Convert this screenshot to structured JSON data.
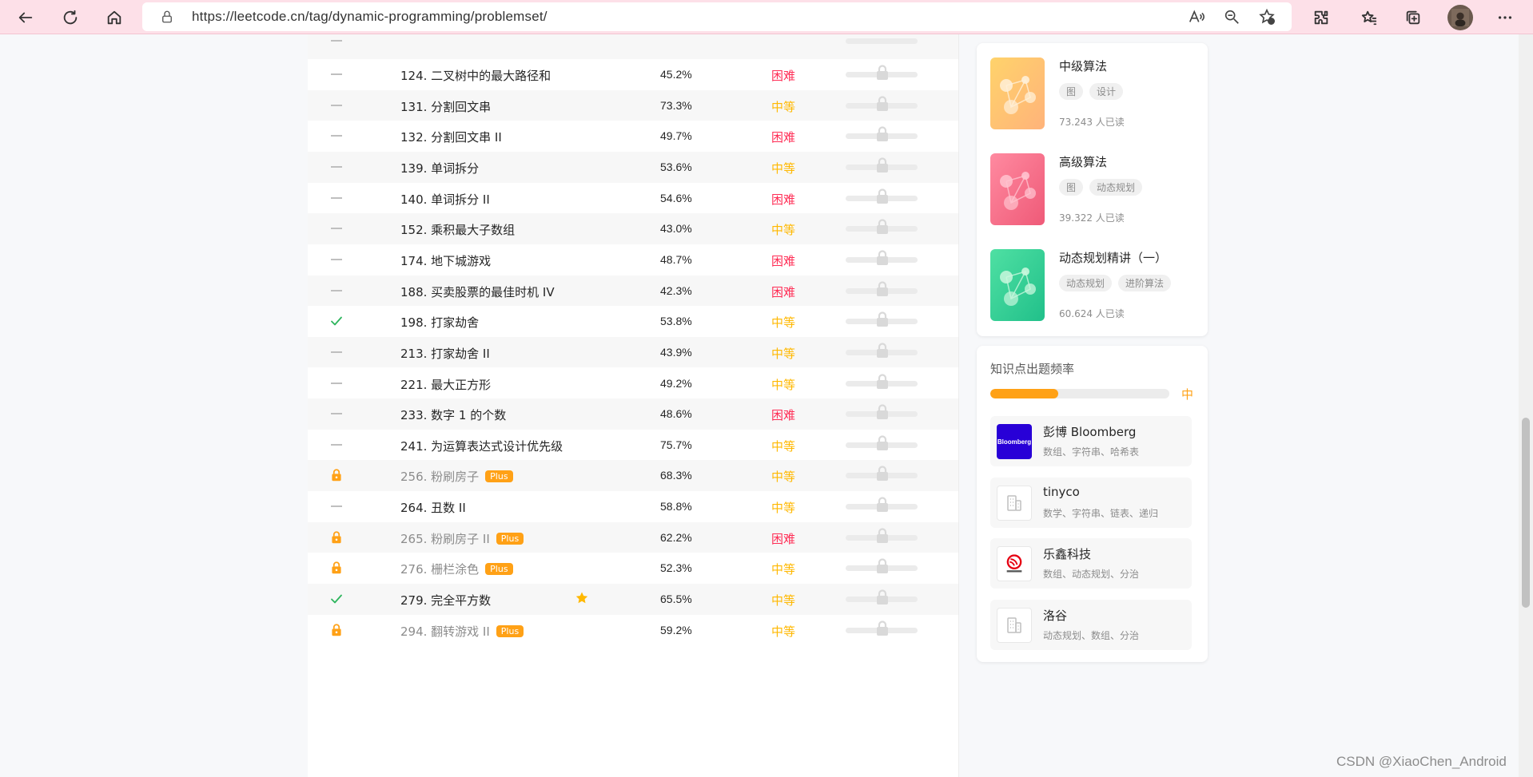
{
  "browser": {
    "url": "https://leetcode.cn/tag/dynamic-programming/problemset/",
    "icons": [
      "back-icon",
      "refresh-icon",
      "home-icon",
      "lock-icon",
      "read-aloud-icon",
      "zoom-out-icon",
      "favorite-add-icon",
      "extensions-icon",
      "favorites-icon",
      "collections-icon",
      "profile-avatar",
      "more-icon"
    ]
  },
  "colors": {
    "medium": "#ffb800",
    "hard": "#ff2d55",
    "accent": "#ffa116",
    "solved": "#2db55d"
  },
  "problems": [
    {
      "status": "none",
      "title": "124. 二叉树中的最大路径和",
      "rate": "45.2%",
      "difficulty": "困难",
      "level": "hard",
      "premium": false,
      "starred": false
    },
    {
      "status": "none",
      "title": "131. 分割回文串",
      "rate": "73.3%",
      "difficulty": "中等",
      "level": "mid",
      "premium": false,
      "starred": false
    },
    {
      "status": "none",
      "title": "132. 分割回文串 II",
      "rate": "49.7%",
      "difficulty": "困难",
      "level": "hard",
      "premium": false,
      "starred": false
    },
    {
      "status": "none",
      "title": "139. 单词拆分",
      "rate": "53.6%",
      "difficulty": "中等",
      "level": "mid",
      "premium": false,
      "starred": false
    },
    {
      "status": "none",
      "title": "140. 单词拆分 II",
      "rate": "54.6%",
      "difficulty": "困难",
      "level": "hard",
      "premium": false,
      "starred": false
    },
    {
      "status": "none",
      "title": "152. 乘积最大子数组",
      "rate": "43.0%",
      "difficulty": "中等",
      "level": "mid",
      "premium": false,
      "starred": false
    },
    {
      "status": "none",
      "title": "174. 地下城游戏",
      "rate": "48.7%",
      "difficulty": "困难",
      "level": "hard",
      "premium": false,
      "starred": false
    },
    {
      "status": "none",
      "title": "188. 买卖股票的最佳时机 IV",
      "rate": "42.3%",
      "difficulty": "困难",
      "level": "hard",
      "premium": false,
      "starred": false
    },
    {
      "status": "solved",
      "title": "198. 打家劫舍",
      "rate": "53.8%",
      "difficulty": "中等",
      "level": "mid",
      "premium": false,
      "starred": false
    },
    {
      "status": "none",
      "title": "213. 打家劫舍 II",
      "rate": "43.9%",
      "difficulty": "中等",
      "level": "mid",
      "premium": false,
      "starred": false
    },
    {
      "status": "none",
      "title": "221. 最大正方形",
      "rate": "49.2%",
      "difficulty": "中等",
      "level": "mid",
      "premium": false,
      "starred": false
    },
    {
      "status": "none",
      "title": "233. 数字 1 的个数",
      "rate": "48.6%",
      "difficulty": "困难",
      "level": "hard",
      "premium": false,
      "starred": false
    },
    {
      "status": "none",
      "title": "241. 为运算表达式设计优先级",
      "rate": "75.7%",
      "difficulty": "中等",
      "level": "mid",
      "premium": false,
      "starred": false
    },
    {
      "status": "locked",
      "title": "256. 粉刷房子",
      "rate": "68.3%",
      "difficulty": "中等",
      "level": "mid",
      "premium": true,
      "starred": false
    },
    {
      "status": "none",
      "title": "264. 丑数 II",
      "rate": "58.8%",
      "difficulty": "中等",
      "level": "mid",
      "premium": false,
      "starred": false
    },
    {
      "status": "locked",
      "title": "265. 粉刷房子 II",
      "rate": "62.2%",
      "difficulty": "困难",
      "level": "hard",
      "premium": true,
      "starred": false
    },
    {
      "status": "locked",
      "title": "276. 栅栏涂色",
      "rate": "52.3%",
      "difficulty": "中等",
      "level": "mid",
      "premium": true,
      "starred": false
    },
    {
      "status": "solved",
      "title": "279. 完全平方数",
      "rate": "65.5%",
      "difficulty": "中等",
      "level": "mid",
      "premium": false,
      "starred": true
    },
    {
      "status": "locked",
      "title": "294. 翻转游戏 II",
      "rate": "59.2%",
      "difficulty": "中等",
      "level": "mid",
      "premium": true,
      "starred": false
    }
  ],
  "plus_label": "Plus",
  "cards": [
    {
      "title": "中级算法",
      "tags": [
        "图",
        "设计"
      ],
      "reads": "73.243 人已读",
      "theme": "orange"
    },
    {
      "title": "高级算法",
      "tags": [
        "图",
        "动态规划"
      ],
      "reads": "39.322 人已读",
      "theme": "pink"
    },
    {
      "title": "动态规划精讲（一）",
      "tags": [
        "动态规划",
        "进阶算法"
      ],
      "reads": "60.624 人已读",
      "theme": "green"
    }
  ],
  "frequency": {
    "title": "知识点出题频率",
    "level": "中",
    "fill": 0.38
  },
  "companies": [
    {
      "name": "彭博 Bloomberg",
      "topics": "数组、字符串、哈希表",
      "logo": "Bloomberg"
    },
    {
      "name": "tinyco",
      "topics": "数学、字符串、链表、递归",
      "logo": "building-icon"
    },
    {
      "name": "乐鑫科技",
      "topics": "数组、动态规划、分治",
      "logo": "espressif-logo"
    },
    {
      "name": "洛谷",
      "topics": "动态规划、数组、分治",
      "logo": "building-icon"
    }
  ],
  "watermark": "CSDN @XiaoChen_Android"
}
